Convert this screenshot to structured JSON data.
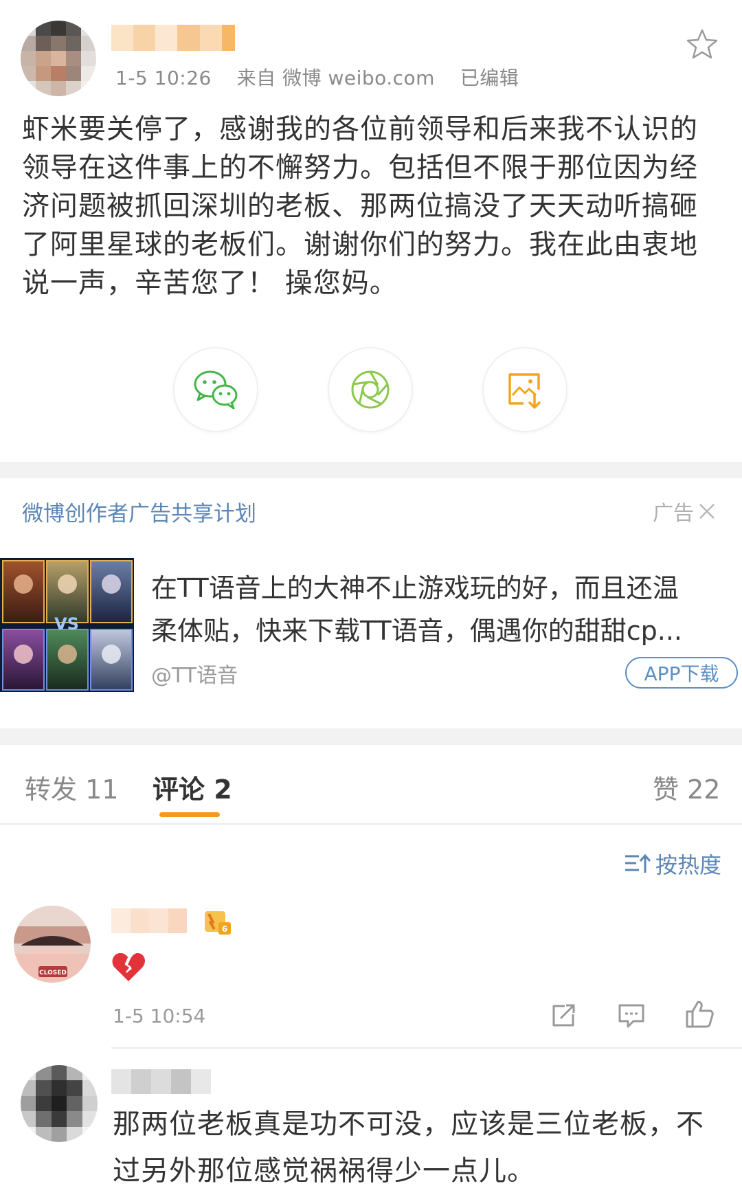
{
  "post": {
    "meta_time": "1-5 10:26",
    "meta_source": "来自 微博 weibo.com",
    "meta_edited": "已编辑",
    "text": "虾米要关停了，感谢我的各位前领导和后来我不认识的领导在这件事上的不懈努力。包括但不限于那位因为经济问题被抓回深圳的老板、那两位搞没了天天动听搞砸了阿里星球的老板们。谢谢你们的努力。我在此由衷地说一声，辛苦您了！ 操您妈。",
    "lines": [
      "虾米要关停了，感谢我的各位前领导和后来我不认识的",
      "领导在这件事上的不懈努力。包括但不限于那位因为经",
      "济问题被抓回深圳的老板、那两位搞没了天天动听搞砸",
      "了阿里星球的老板们。谢谢你们的努力。我在此由衷地",
      "说一声，辛苦您了！ 操您妈。"
    ],
    "share_icons": [
      "wechat-icon",
      "moments-icon",
      "save-image-icon"
    ]
  },
  "ad": {
    "plan": "微博创作者广告共享计划",
    "tag": "广告",
    "line1": "在TT语音上的大神不止游戏玩的好，而且还温",
    "line2": "柔体贴，快来下载TT语音，偶遇你的甜甜cp...",
    "account": "@TT语音",
    "app_button": "APP下载"
  },
  "tabs": {
    "repost": "转发 11",
    "comments": "评论 2",
    "likes": "赞 22"
  },
  "sort_label": "按热度",
  "comments": [
    {
      "time": "1-5 10:54",
      "content_icon": "broken-heart-icon"
    },
    {
      "line1": "那两位老板真是功不可没，应该是三位老板，不",
      "line2": "过另外那位感觉祸祸得少一点儿。"
    }
  ],
  "colors": {
    "accent_orange": "#f29a1e",
    "link_blue": "#5b86b5",
    "wechat_green": "#44b549",
    "moments_green": "#8cc84b",
    "save_orange": "#f2a51a"
  }
}
